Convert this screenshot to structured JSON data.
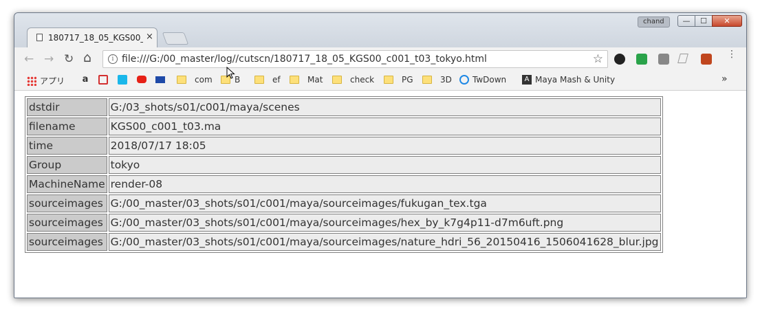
{
  "window": {
    "user": "chand",
    "controls": {
      "minimize": "—",
      "maximize": "☐",
      "close": "✕"
    }
  },
  "tab": {
    "title": "180717_18_05_KGS00_c001_t03_tokyo.html",
    "close": "×"
  },
  "toolbar": {
    "back": "←",
    "forward": "→",
    "reload": "↻",
    "home": "⌂",
    "info": "i",
    "url": "file:///G:/00_master/log//cutscn/180717_18_05_KGS00_c001_t03_tokyo.html",
    "star": "☆",
    "menu": "⋮"
  },
  "bookmarks": {
    "apps": "アプリ",
    "items": [
      "com",
      "B",
      "ef",
      "Mat",
      "check",
      "PG",
      "3D",
      "TwDown",
      "Maya Mash & Unity"
    ],
    "overflow": "»"
  },
  "log_table": {
    "rows": [
      {
        "key": "dstdir",
        "value": "G:/03_shots/s01/c001/maya/scenes"
      },
      {
        "key": "filename",
        "value": "KGS00_c001_t03.ma"
      },
      {
        "key": "time",
        "value": "2018/07/17 18:05"
      },
      {
        "key": "Group",
        "value": "tokyo"
      },
      {
        "key": "MachineName",
        "value": "render-08"
      },
      {
        "key": "sourceimages",
        "value": "G:/00_master/03_shots/s01/c001/maya/sourceimages/fukugan_tex.tga"
      },
      {
        "key": "sourceimages",
        "value": "G:/00_master/03_shots/s01/c001/maya/sourceimages/hex_by_k7g4p11-d7m6uft.png"
      },
      {
        "key": "sourceimages",
        "value": "G:/00_master/03_shots/s01/c001/maya/sourceimages/nature_hdri_56_20150416_1506041628_blur.jpg"
      }
    ]
  },
  "colors": {
    "key_cell": "#cbcbcb",
    "value_cell": "#ececec"
  }
}
